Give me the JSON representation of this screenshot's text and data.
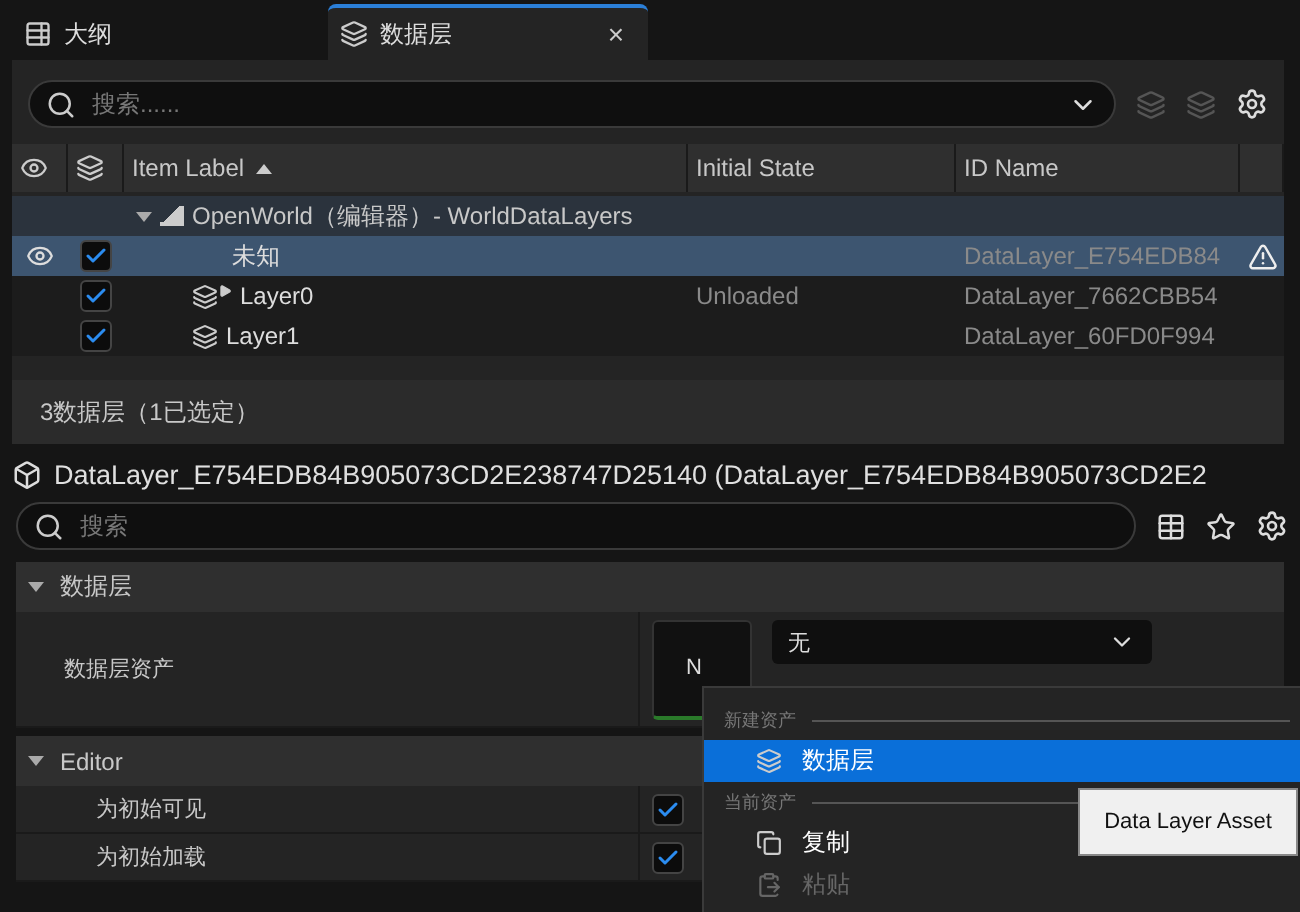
{
  "tabs": [
    {
      "label": "大纲",
      "selected": false
    },
    {
      "label": "数据层",
      "selected": true,
      "close": "×"
    }
  ],
  "outliner": {
    "search_placeholder": "搜索......",
    "columns": [
      {
        "label": "Item Label",
        "sorted": true
      },
      {
        "label": "Initial State",
        "sorted": false
      },
      {
        "label": "ID Name",
        "sorted": false
      }
    ],
    "rows": [
      {
        "kind": "world",
        "label": "OpenWorld（编辑器）- WorldDataLayers",
        "expanded": true,
        "children": [
          {
            "kind": "unknown",
            "label": "未知",
            "id": "DataLayer_E754EDB84",
            "checked": true,
            "selected": true,
            "eye": true,
            "warning": true
          },
          {
            "kind": "streaming",
            "label": "Layer0",
            "state": "Unloaded",
            "id": "DataLayer_7662CBB54",
            "checked": true,
            "selected": false,
            "eye": false,
            "warning": false
          },
          {
            "kind": "layer",
            "label": "Layer1",
            "id": "DataLayer_60FD0F994",
            "checked": true,
            "selected": false,
            "eye": false,
            "warning": false
          }
        ]
      }
    ],
    "status": "3数据层（1已选定）"
  },
  "details": {
    "title": "DataLayer_E754EDB84B905073CD2E238747D25140 (DataLayer_E754EDB84B905073CD2E2",
    "search_placeholder": "搜索",
    "categories": [
      {
        "label": "数据层",
        "expanded": true,
        "properties": [
          {
            "kind": "asset",
            "label": "数据层资产",
            "thumbnail": "N",
            "value": "无"
          }
        ]
      },
      {
        "label": "Editor",
        "expanded": true,
        "properties": [
          {
            "kind": "checkbox",
            "label": "为初始可见",
            "checked": true
          },
          {
            "kind": "checkbox",
            "label": "为初始加载",
            "checked": true
          }
        ]
      }
    ]
  },
  "menu": {
    "sections": [
      {
        "header": "新建资产",
        "items": [
          {
            "label": "数据层",
            "selected": true,
            "disabled": false
          }
        ]
      },
      {
        "header": "当前资产",
        "items": [
          {
            "label": "复制",
            "selected": false,
            "disabled": false
          },
          {
            "label": "粘贴",
            "selected": false,
            "disabled": true
          }
        ]
      }
    ]
  },
  "tooltip": "Data Layer Asset"
}
